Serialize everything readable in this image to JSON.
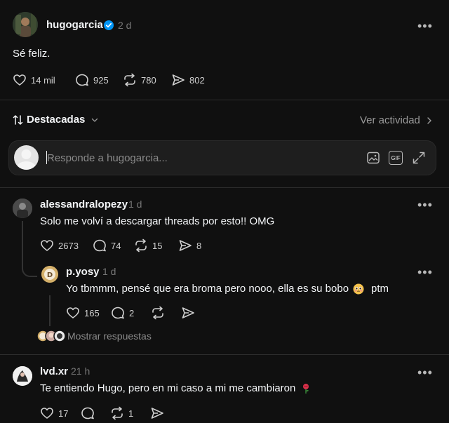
{
  "post": {
    "username": "hugogarcia",
    "verified": true,
    "time": "2 d",
    "text": "Sé feliz.",
    "likes": "14 mil",
    "replies": "925",
    "reposts": "780",
    "shares": "802"
  },
  "sort": {
    "label": "Destacadas",
    "activity_link": "Ver actividad"
  },
  "composer": {
    "placeholder": "Responde a hugogarcia...",
    "gif_label": "GIF"
  },
  "comments": [
    {
      "username": "alessandralopezy",
      "time": "1 d",
      "text": "Solo me volví a descargar threads por esto!! OMG",
      "likes": "2673",
      "replies": "74",
      "reposts": "15",
      "shares": "8"
    },
    {
      "username": "p.yosy",
      "time": "1 d",
      "text": "Yo tbmmm, pensé que era broma pero nooo, ella es su bobo",
      "text_end": "ptm",
      "likes": "165",
      "replies": "2"
    },
    {
      "username": "lvd.xr",
      "time": "21 h",
      "text": "Te entiendo Hugo, pero en mi caso a mi me cambiaron",
      "likes": "17",
      "reposts": "1"
    }
  ],
  "show_replies": "Mostrar respuestas",
  "colors": {
    "background": "#101010",
    "verified": "#0095f6",
    "muted": "#777777",
    "input_bg": "#1e1e1e"
  }
}
